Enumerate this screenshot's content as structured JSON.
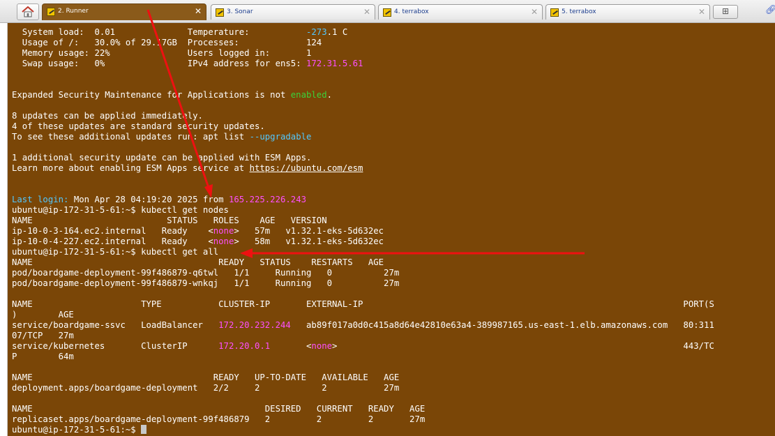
{
  "tabs": [
    {
      "label": "2. Runner",
      "active": true
    },
    {
      "label": "3. Sonar",
      "active": false
    },
    {
      "label": "4. terrabox",
      "active": false
    },
    {
      "label": "5. terrabox",
      "active": false
    }
  ],
  "icons": {
    "home": "home-icon",
    "tab": "terminal-tool-icon",
    "new_tab": "new-tab-icon",
    "menu": "chain-link-icon",
    "close": "close-icon"
  },
  "colors": {
    "terminal_bg": "#7a4607",
    "text": "#ffffff",
    "magenta": "#ff4fff",
    "green": "#3bd23b",
    "cyan": "#52c8ff",
    "arrow": "#ee1111"
  },
  "terminal": {
    "sys": [
      {
        "a": "  System load:  0.01              ",
        "b": "Temperature:           ",
        "c": "-273",
        "d": ".1 C"
      },
      {
        "a": "  Usage of /:   30.0% of 29.17GB  ",
        "b": "Processes:             124"
      },
      {
        "a": "  Memory usage: 22%               ",
        "b": "Users logged in:       1"
      },
      {
        "a": "  Swap usage:   0%                ",
        "b": "IPv4 address for ens5: ",
        "c": "172.31.5.61"
      }
    ],
    "esm_line": {
      "a": "Expanded Security Maintenance for Applications is not ",
      "b": "enabled",
      "c": "."
    },
    "updates": [
      "8 updates can be applied immediately.",
      "4 of these updates are standard security updates."
    ],
    "see_line": {
      "a": "To see these additional updates run: apt list ",
      "b": "--upgradable"
    },
    "esm_apps": [
      "1 additional security update can be applied with ESM Apps."
    ],
    "learn_line": {
      "a": "Learn more about enabling ESM Apps service at ",
      "b": "https://ubuntu.com/esm"
    },
    "last_login": {
      "a": "Last login:",
      "b": " Mon Apr 28 04:19:20 2025 from ",
      "c": "165.225.226.243"
    },
    "prompt": "ubuntu@ip-172-31-5-61:~$ ",
    "cmd_nodes": "kubectl get nodes",
    "nodes_header": "NAME                          STATUS   ROLES    AGE   VERSION",
    "nodes": [
      {
        "a": "ip-10-0-3-164.ec2.internal   Ready    <",
        "b": "none",
        "c": ">   57m   v1.32.1-eks-5d632ec"
      },
      {
        "a": "ip-10-0-4-227.ec2.internal   Ready    <",
        "b": "none",
        "c": ">   58m   v1.32.1-eks-5d632ec"
      }
    ],
    "cmd_all": "kubectl get all",
    "pods_header": "NAME                                    READY   STATUS    RESTARTS   AGE",
    "pods": [
      "pod/boardgame-deployment-99f486879-q6twl   1/1     Running   0          27m",
      "pod/boardgame-deployment-99f486879-wnkqj   1/1     Running   0          27m"
    ],
    "svc_header": "NAME                     TYPE           CLUSTER-IP       EXTERNAL-IP                                                              PORT(S",
    "svc_header_wrap": ")        AGE",
    "svc1": {
      "a": "service/boardgame-ssvc   LoadBalancer   ",
      "b": "172.20.232.244",
      "c": "   ab89f017a0d0c415a8d64e42810e63a4-389987165.us-east-1.elb.amazonaws.com   80:311"
    },
    "svc1_wrap": "07/TCP   27m",
    "svc2": {
      "a": "service/kubernetes       ClusterIP      ",
      "b": "172.20.0.1",
      "c": "       <",
      "d": "none",
      "e": ">                                                                   443/TC"
    },
    "svc2_wrap": "P        64m",
    "deploy_header": "NAME                                   READY   UP-TO-DATE   AVAILABLE   AGE",
    "deploy_row": "deployment.apps/boardgame-deployment   2/2     2            2           27m",
    "rs_header": "NAME                                             DESIRED   CURRENT   READY   AGE",
    "rs_row": "replicaset.apps/boardgame-deployment-99f486879   2         2         2       27m"
  }
}
